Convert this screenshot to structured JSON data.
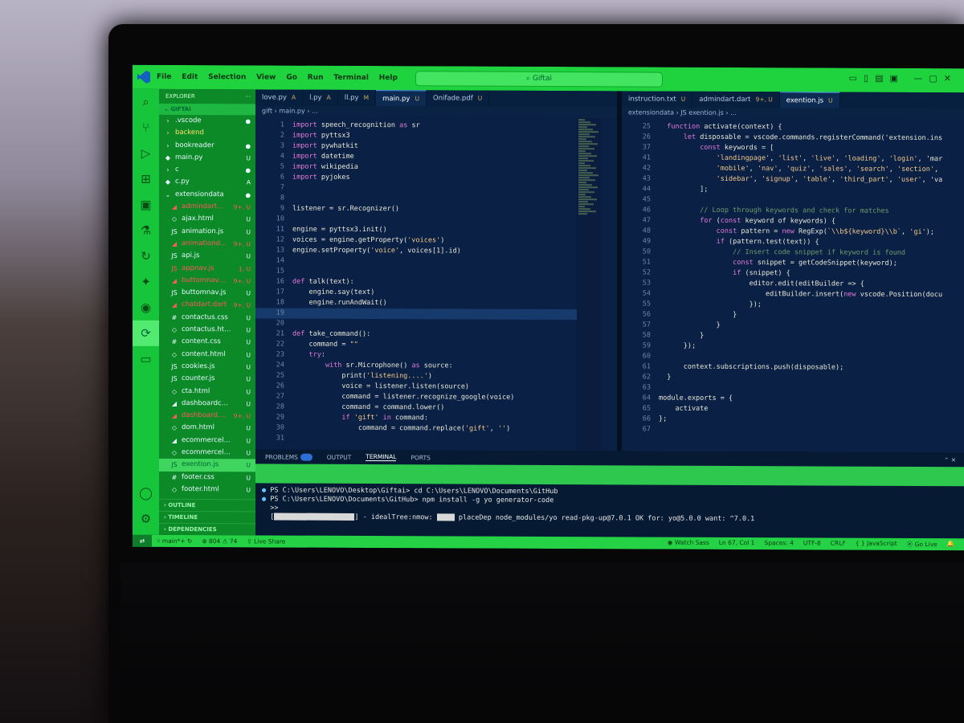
{
  "titlebar": {
    "menu": [
      "File",
      "Edit",
      "Selection",
      "View",
      "Go",
      "Run",
      "Terminal",
      "Help"
    ],
    "search": "Giftai"
  },
  "activity_icons": [
    "files-icon",
    "search-icon",
    "source-control-icon",
    "run-debug-icon",
    "extensions-icon",
    "remote-explorer-icon",
    "testing-icon",
    "live-share-icon",
    "docker-icon",
    "github-icon",
    "copilot-icon",
    "chat-icon"
  ],
  "sidebar": {
    "header": "EXPLORER",
    "folder": "GIFTAI",
    "items": [
      {
        "name": ".vscode",
        "icon": "›",
        "status": "●",
        "color": "#e8f8ff"
      },
      {
        "name": "backend",
        "icon": "›",
        "status": "",
        "color": "#ffe066"
      },
      {
        "name": "bookreader",
        "icon": "›",
        "status": "●",
        "color": "#e8f8ff"
      },
      {
        "name": "main.py",
        "icon": "◆",
        "status": "U",
        "color": "#e8f8ff"
      },
      {
        "name": "c",
        "icon": "›",
        "status": "●",
        "color": "#e8f8ff"
      },
      {
        "name": "c.py",
        "icon": "◆",
        "status": "A",
        "color": "#e8f8ff"
      },
      {
        "name": "extensiondata",
        "icon": "⌄",
        "status": "●",
        "color": "#e8f8ff"
      },
      {
        "name": "admindart...",
        "icon": "◢",
        "status": "9+, U",
        "color": "#ff5a5a"
      },
      {
        "name": "ajax.html",
        "icon": "◇",
        "status": "U",
        "color": "#e8f8ff"
      },
      {
        "name": "animation.js",
        "icon": "JS",
        "status": "U",
        "color": "#e8f8ff"
      },
      {
        "name": "animationd...",
        "icon": "◢",
        "status": "9+, U",
        "color": "#ff5a5a"
      },
      {
        "name": "api.js",
        "icon": "JS",
        "status": "U",
        "color": "#e8f8ff"
      },
      {
        "name": "appnav.js",
        "icon": "JS",
        "status": "1, U",
        "color": "#ff5a5a"
      },
      {
        "name": "buttomnav....",
        "icon": "◢",
        "status": "9+, U",
        "color": "#ff5a5a"
      },
      {
        "name": "buttomnav.js",
        "icon": "JS",
        "status": "U",
        "color": "#e8f8ff"
      },
      {
        "name": "chatdart.dart",
        "icon": "◢",
        "status": "9+, U",
        "color": "#ff5a5a"
      },
      {
        "name": "contactus.css",
        "icon": "#",
        "status": "U",
        "color": "#e8f8ff"
      },
      {
        "name": "contactus.html",
        "icon": "◇",
        "status": "U",
        "color": "#e8f8ff"
      },
      {
        "name": "content.css",
        "icon": "#",
        "status": "U",
        "color": "#e8f8ff"
      },
      {
        "name": "content.html",
        "icon": "◇",
        "status": "U",
        "color": "#e8f8ff"
      },
      {
        "name": "cookies.js",
        "icon": "JS",
        "status": "U",
        "color": "#e8f8ff"
      },
      {
        "name": "counter.js",
        "icon": "JS",
        "status": "U",
        "color": "#e8f8ff"
      },
      {
        "name": "cta.html",
        "icon": "◇",
        "status": "U",
        "color": "#e8f8ff"
      },
      {
        "name": "dashboardcom...",
        "icon": "◢",
        "status": "U",
        "color": "#e8f8ff"
      },
      {
        "name": "dashboard....",
        "icon": "◢",
        "status": "9+, U",
        "color": "#ff5a5a"
      },
      {
        "name": "dom.html",
        "icon": "◇",
        "status": "U",
        "color": "#e8f8ff"
      },
      {
        "name": "ecommercelan...",
        "icon": "◢",
        "status": "U",
        "color": "#e8f8ff"
      },
      {
        "name": "ecommercelan...",
        "icon": "◇",
        "status": "U",
        "color": "#e8f8ff"
      },
      {
        "name": "exention.js",
        "icon": "JS",
        "status": "U",
        "color": "#063"
      },
      {
        "name": "footer.css",
        "icon": "#",
        "status": "U",
        "color": "#e8f8ff"
      },
      {
        "name": "footer.html",
        "icon": "◇",
        "status": "U",
        "color": "#e8f8ff"
      }
    ],
    "sections": [
      "OUTLINE",
      "TIMELINE",
      "DEPENDENCIES"
    ]
  },
  "left_editor": {
    "tabs": [
      {
        "label": "love.py",
        "state": "A"
      },
      {
        "label": "l.py",
        "state": "A"
      },
      {
        "label": "ll.py",
        "state": "M"
      },
      {
        "label": "main.py",
        "state": "U"
      },
      {
        "label": "Onifade.pdf",
        "state": "U"
      }
    ],
    "breadcrumb": "gift  ›  main.py  ›  ...",
    "lines": [
      {
        "n": "1",
        "t": "import speech_recognition as sr"
      },
      {
        "n": "2",
        "t": "import pyttsx3"
      },
      {
        "n": "3",
        "t": "import pywhatkit"
      },
      {
        "n": "4",
        "t": "import datetime"
      },
      {
        "n": "5",
        "t": "import wikipedia"
      },
      {
        "n": "6",
        "t": "import pyjokes"
      },
      {
        "n": "7",
        "t": ""
      },
      {
        "n": "8",
        "t": ""
      },
      {
        "n": "9",
        "t": "listener = sr.Recognizer()"
      },
      {
        "n": "10",
        "t": ""
      },
      {
        "n": "11",
        "t": "engine = pyttsx3.init()"
      },
      {
        "n": "12",
        "t": "voices = engine.getProperty('voices')"
      },
      {
        "n": "13",
        "t": "engine.setProperty('voice', voices[1].id)"
      },
      {
        "n": "14",
        "t": ""
      },
      {
        "n": "15",
        "t": ""
      },
      {
        "n": "16",
        "t": "def talk(text):"
      },
      {
        "n": "17",
        "t": "    engine.say(text)"
      },
      {
        "n": "18",
        "t": "    engine.runAndWait()"
      },
      {
        "n": "19",
        "t": ""
      },
      {
        "n": "20",
        "t": ""
      },
      {
        "n": "21",
        "t": "def take_command():"
      },
      {
        "n": "22",
        "t": "    command = \"\""
      },
      {
        "n": "23",
        "t": "    try:"
      },
      {
        "n": "24",
        "t": "        with sr.Microphone() as source:"
      },
      {
        "n": "25",
        "t": "            print('listening....')"
      },
      {
        "n": "26",
        "t": "            voice = listener.listen(source)"
      },
      {
        "n": "27",
        "t": "            command = listener.recognize_google(voice)"
      },
      {
        "n": "28",
        "t": "            command = command.lower()"
      },
      {
        "n": "29",
        "t": "            if 'gift' in command:"
      },
      {
        "n": "30",
        "t": "                command = command.replace('gift', '')"
      },
      {
        "n": "31",
        "t": ""
      }
    ]
  },
  "right_editor": {
    "tabs": [
      {
        "label": "instruction.txt",
        "state": "U"
      },
      {
        "label": "admindart.dart",
        "state": "9+, U"
      },
      {
        "label": "exention.js",
        "state": "U"
      }
    ],
    "breadcrumb": "extensiondata  ›  JS exention.js  ›  ...",
    "lines": [
      {
        "n": "25",
        "t": "  function activate(context) {"
      },
      {
        "n": "26",
        "t": "      let disposable = vscode.commands.registerCommand('extension.ins"
      },
      {
        "n": "37",
        "t": "          const keywords = ["
      },
      {
        "n": "41",
        "t": "              'landingpage', 'list', 'live', 'loading', 'login', 'mar"
      },
      {
        "n": "42",
        "t": "              'mobile', 'nav', 'quiz', 'sales', 'search', 'section',"
      },
      {
        "n": "43",
        "t": "              'sidebar', 'signup', 'table', 'third_part', 'user', 'va"
      },
      {
        "n": "44",
        "t": "          ];"
      },
      {
        "n": "45",
        "t": ""
      },
      {
        "n": "46",
        "t": "          // Loop through keywords and check for matches"
      },
      {
        "n": "47",
        "t": "          for (const keyword of keywords) {"
      },
      {
        "n": "48",
        "t": "              const pattern = new RegExp(`\\\\b${keyword}\\\\b`, 'gi');"
      },
      {
        "n": "49",
        "t": "              if (pattern.test(text)) {"
      },
      {
        "n": "50",
        "t": "                  // Insert code snippet if keyword is found"
      },
      {
        "n": "51",
        "t": "                  const snippet = getCodeSnippet(keyword);"
      },
      {
        "n": "52",
        "t": "                  if (snippet) {"
      },
      {
        "n": "53",
        "t": "                      editor.edit(editBuilder => {"
      },
      {
        "n": "54",
        "t": "                          editBuilder.insert(new vscode.Position(docu"
      },
      {
        "n": "55",
        "t": "                      });"
      },
      {
        "n": "56",
        "t": "                  }"
      },
      {
        "n": "57",
        "t": "              }"
      },
      {
        "n": "58",
        "t": "          }"
      },
      {
        "n": "59",
        "t": "      });"
      },
      {
        "n": "60",
        "t": ""
      },
      {
        "n": "61",
        "t": "      context.subscriptions.push(disposable);"
      },
      {
        "n": "62",
        "t": "  }"
      },
      {
        "n": "63",
        "t": ""
      },
      {
        "n": "64",
        "t": "module.exports = {"
      },
      {
        "n": "65",
        "t": "    activate"
      },
      {
        "n": "66",
        "t": "};"
      },
      {
        "n": "67",
        "t": ""
      }
    ]
  },
  "panel": {
    "tabs": [
      "PROBLEMS",
      "OUTPUT",
      "TERMINAL",
      "PORTS"
    ],
    "problems_count": "",
    "terminal": [
      "PS C:\\Users\\LENOVO\\Desktop\\Giftai> cd C:\\Users\\LENOVO\\Documents\\GitHub",
      "PS C:\\Users\\LENOVO\\Documents\\GitHub> npm install -g yo generator-code",
      ">>"
    ],
    "progress_text": "] - idealTree:nmow:",
    "progress_tail": "placeDep node_modules/yo read-pkg-up@7.0.1 OK for: yo@5.0.0 want: ^7.0.1"
  },
  "statusbar": {
    "branch": "main*+",
    "errors": "804",
    "warnings": "74",
    "liveshare": "Live Share",
    "watch": "Watch Sass",
    "position": "Ln 67, Col 1",
    "spaces": "Spaces: 4",
    "encoding": "UTF-8",
    "eol": "CRLF",
    "language": "JavaScript",
    "golive": "Go Live"
  }
}
